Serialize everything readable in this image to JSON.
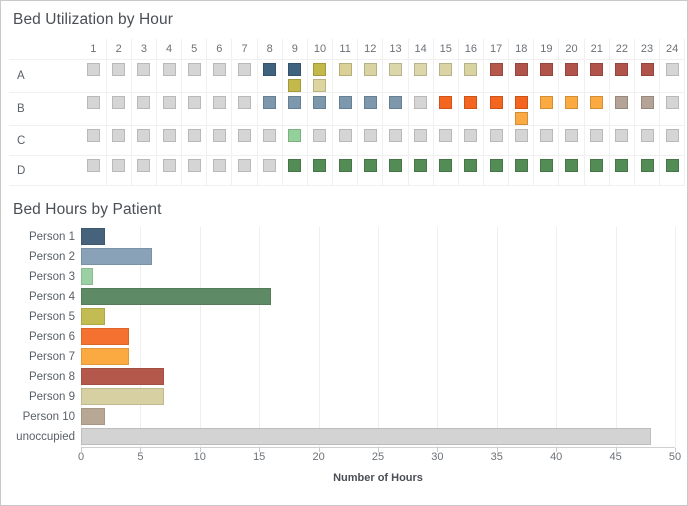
{
  "panels": {
    "utilization_title": "Bed Utilization by Hour",
    "hours_title": "Bed Hours by Patient"
  },
  "heatmap": {
    "hours": [
      "1",
      "2",
      "3",
      "4",
      "5",
      "6",
      "7",
      "8",
      "9",
      "10",
      "11",
      "12",
      "13",
      "14",
      "15",
      "16",
      "17",
      "18",
      "19",
      "20",
      "21",
      "22",
      "23",
      "24"
    ],
    "row_labels": [
      "A",
      "B",
      "C",
      "D"
    ],
    "empty_color": "#d5d5d5",
    "rows": [
      {
        "label": "A",
        "cells": [
          {
            "colors": [
              "#d5d5d5"
            ]
          },
          {
            "colors": [
              "#d5d5d5"
            ]
          },
          {
            "colors": [
              "#d5d5d5"
            ]
          },
          {
            "colors": [
              "#d5d5d5"
            ]
          },
          {
            "colors": [
              "#d5d5d5"
            ]
          },
          {
            "colors": [
              "#d5d5d5"
            ]
          },
          {
            "colors": [
              "#d5d5d5"
            ]
          },
          {
            "colors": [
              "#3f637f"
            ]
          },
          {
            "colors": [
              "#3f637f",
              "#c3b84a"
            ]
          },
          {
            "colors": [
              "#c3b84a",
              "#dcd5a0"
            ]
          },
          {
            "colors": [
              "#d9d196"
            ]
          },
          {
            "colors": [
              "#d9d3a2"
            ]
          },
          {
            "colors": [
              "#dcd6ab"
            ]
          },
          {
            "colors": [
              "#dcd6ab"
            ]
          },
          {
            "colors": [
              "#dad4a4"
            ]
          },
          {
            "colors": [
              "#d9d3a2"
            ]
          },
          {
            "colors": [
              "#b6574b"
            ]
          },
          {
            "colors": [
              "#b0534a"
            ]
          },
          {
            "colors": [
              "#b0534a"
            ]
          },
          {
            "colors": [
              "#b0534a"
            ]
          },
          {
            "colors": [
              "#b0534a"
            ]
          },
          {
            "colors": [
              "#b0534a"
            ]
          },
          {
            "colors": [
              "#b0534a"
            ]
          },
          {
            "colors": [
              "#d5d5d5"
            ]
          }
        ]
      },
      {
        "label": "B",
        "cells": [
          {
            "colors": [
              "#d5d5d5"
            ]
          },
          {
            "colors": [
              "#d5d5d5"
            ]
          },
          {
            "colors": [
              "#d5d5d5"
            ]
          },
          {
            "colors": [
              "#d5d5d5"
            ]
          },
          {
            "colors": [
              "#d5d5d5"
            ]
          },
          {
            "colors": [
              "#d5d5d5"
            ]
          },
          {
            "colors": [
              "#d5d5d5"
            ]
          },
          {
            "colors": [
              "#7d97ad"
            ]
          },
          {
            "colors": [
              "#7d97ad"
            ]
          },
          {
            "colors": [
              "#7d97ad"
            ]
          },
          {
            "colors": [
              "#7d97ad"
            ]
          },
          {
            "colors": [
              "#7d97ad"
            ]
          },
          {
            "colors": [
              "#7d97ad"
            ]
          },
          {
            "colors": [
              "#d5d5d5"
            ]
          },
          {
            "colors": [
              "#f4651f"
            ]
          },
          {
            "colors": [
              "#f4651f"
            ]
          },
          {
            "colors": [
              "#f4651f"
            ]
          },
          {
            "colors": [
              "#f4651f",
              "#fbaa42"
            ]
          },
          {
            "colors": [
              "#fbaa42"
            ]
          },
          {
            "colors": [
              "#fbaa42"
            ]
          },
          {
            "colors": [
              "#fbaa42"
            ]
          },
          {
            "colors": [
              "#b4a396"
            ]
          },
          {
            "colors": [
              "#b4a396"
            ]
          },
          {
            "colors": [
              "#d5d5d5"
            ]
          }
        ]
      },
      {
        "label": "C",
        "cells": [
          {
            "colors": [
              "#d5d5d5"
            ]
          },
          {
            "colors": [
              "#d5d5d5"
            ]
          },
          {
            "colors": [
              "#d5d5d5"
            ]
          },
          {
            "colors": [
              "#d5d5d5"
            ]
          },
          {
            "colors": [
              "#d5d5d5"
            ]
          },
          {
            "colors": [
              "#d5d5d5"
            ]
          },
          {
            "colors": [
              "#d5d5d5"
            ]
          },
          {
            "colors": [
              "#d5d5d5"
            ]
          },
          {
            "colors": [
              "#94d19a"
            ]
          },
          {
            "colors": [
              "#d5d5d5"
            ]
          },
          {
            "colors": [
              "#d5d5d5"
            ]
          },
          {
            "colors": [
              "#d5d5d5"
            ]
          },
          {
            "colors": [
              "#d5d5d5"
            ]
          },
          {
            "colors": [
              "#d5d5d5"
            ]
          },
          {
            "colors": [
              "#d5d5d5"
            ]
          },
          {
            "colors": [
              "#d5d5d5"
            ]
          },
          {
            "colors": [
              "#d5d5d5"
            ]
          },
          {
            "colors": [
              "#d5d5d5"
            ]
          },
          {
            "colors": [
              "#d5d5d5"
            ]
          },
          {
            "colors": [
              "#d5d5d5"
            ]
          },
          {
            "colors": [
              "#d5d5d5"
            ]
          },
          {
            "colors": [
              "#d5d5d5"
            ]
          },
          {
            "colors": [
              "#d5d5d5"
            ]
          },
          {
            "colors": [
              "#d5d5d5"
            ]
          }
        ]
      },
      {
        "label": "D",
        "cells": [
          {
            "colors": [
              "#d5d5d5"
            ]
          },
          {
            "colors": [
              "#d5d5d5"
            ]
          },
          {
            "colors": [
              "#d5d5d5"
            ]
          },
          {
            "colors": [
              "#d5d5d5"
            ]
          },
          {
            "colors": [
              "#d5d5d5"
            ]
          },
          {
            "colors": [
              "#d5d5d5"
            ]
          },
          {
            "colors": [
              "#d5d5d5"
            ]
          },
          {
            "colors": [
              "#d5d5d5"
            ]
          },
          {
            "colors": [
              "#548c55"
            ]
          },
          {
            "colors": [
              "#548c55"
            ]
          },
          {
            "colors": [
              "#548c55"
            ]
          },
          {
            "colors": [
              "#548c55"
            ]
          },
          {
            "colors": [
              "#548c55"
            ]
          },
          {
            "colors": [
              "#548c55"
            ]
          },
          {
            "colors": [
              "#548c55"
            ]
          },
          {
            "colors": [
              "#548c55"
            ]
          },
          {
            "colors": [
              "#548c55"
            ]
          },
          {
            "colors": [
              "#548c55"
            ]
          },
          {
            "colors": [
              "#548c55"
            ]
          },
          {
            "colors": [
              "#548c55"
            ]
          },
          {
            "colors": [
              "#548c55"
            ]
          },
          {
            "colors": [
              "#548c55"
            ]
          },
          {
            "colors": [
              "#548c55"
            ]
          },
          {
            "colors": [
              "#548c55"
            ]
          }
        ]
      }
    ]
  },
  "chart_data": {
    "type": "bar",
    "title": "Bed Hours by Patient",
    "orientation": "horizontal",
    "xlabel": "Number of Hours",
    "ylabel": "",
    "xlim": [
      0,
      50
    ],
    "xticks": [
      0,
      5,
      10,
      15,
      20,
      25,
      30,
      35,
      40,
      45,
      50
    ],
    "grid": true,
    "legend": "none",
    "categories": [
      "Person 1",
      "Person 2",
      "Person 3",
      "Person 4",
      "Person 5",
      "Person 6",
      "Person 7",
      "Person 8",
      "Person 9",
      "Person 10",
      "unoccupied"
    ],
    "values": [
      2,
      6,
      1,
      16,
      2,
      4,
      4,
      7,
      7,
      2,
      48
    ],
    "colors": [
      "#47637c",
      "#8aa2b8",
      "#9bd0a5",
      "#5e8b66",
      "#c3bc52",
      "#f4712f",
      "#fbaa42",
      "#b5584c",
      "#d6d0a2",
      "#b8a795",
      "#d3d3d3"
    ]
  }
}
